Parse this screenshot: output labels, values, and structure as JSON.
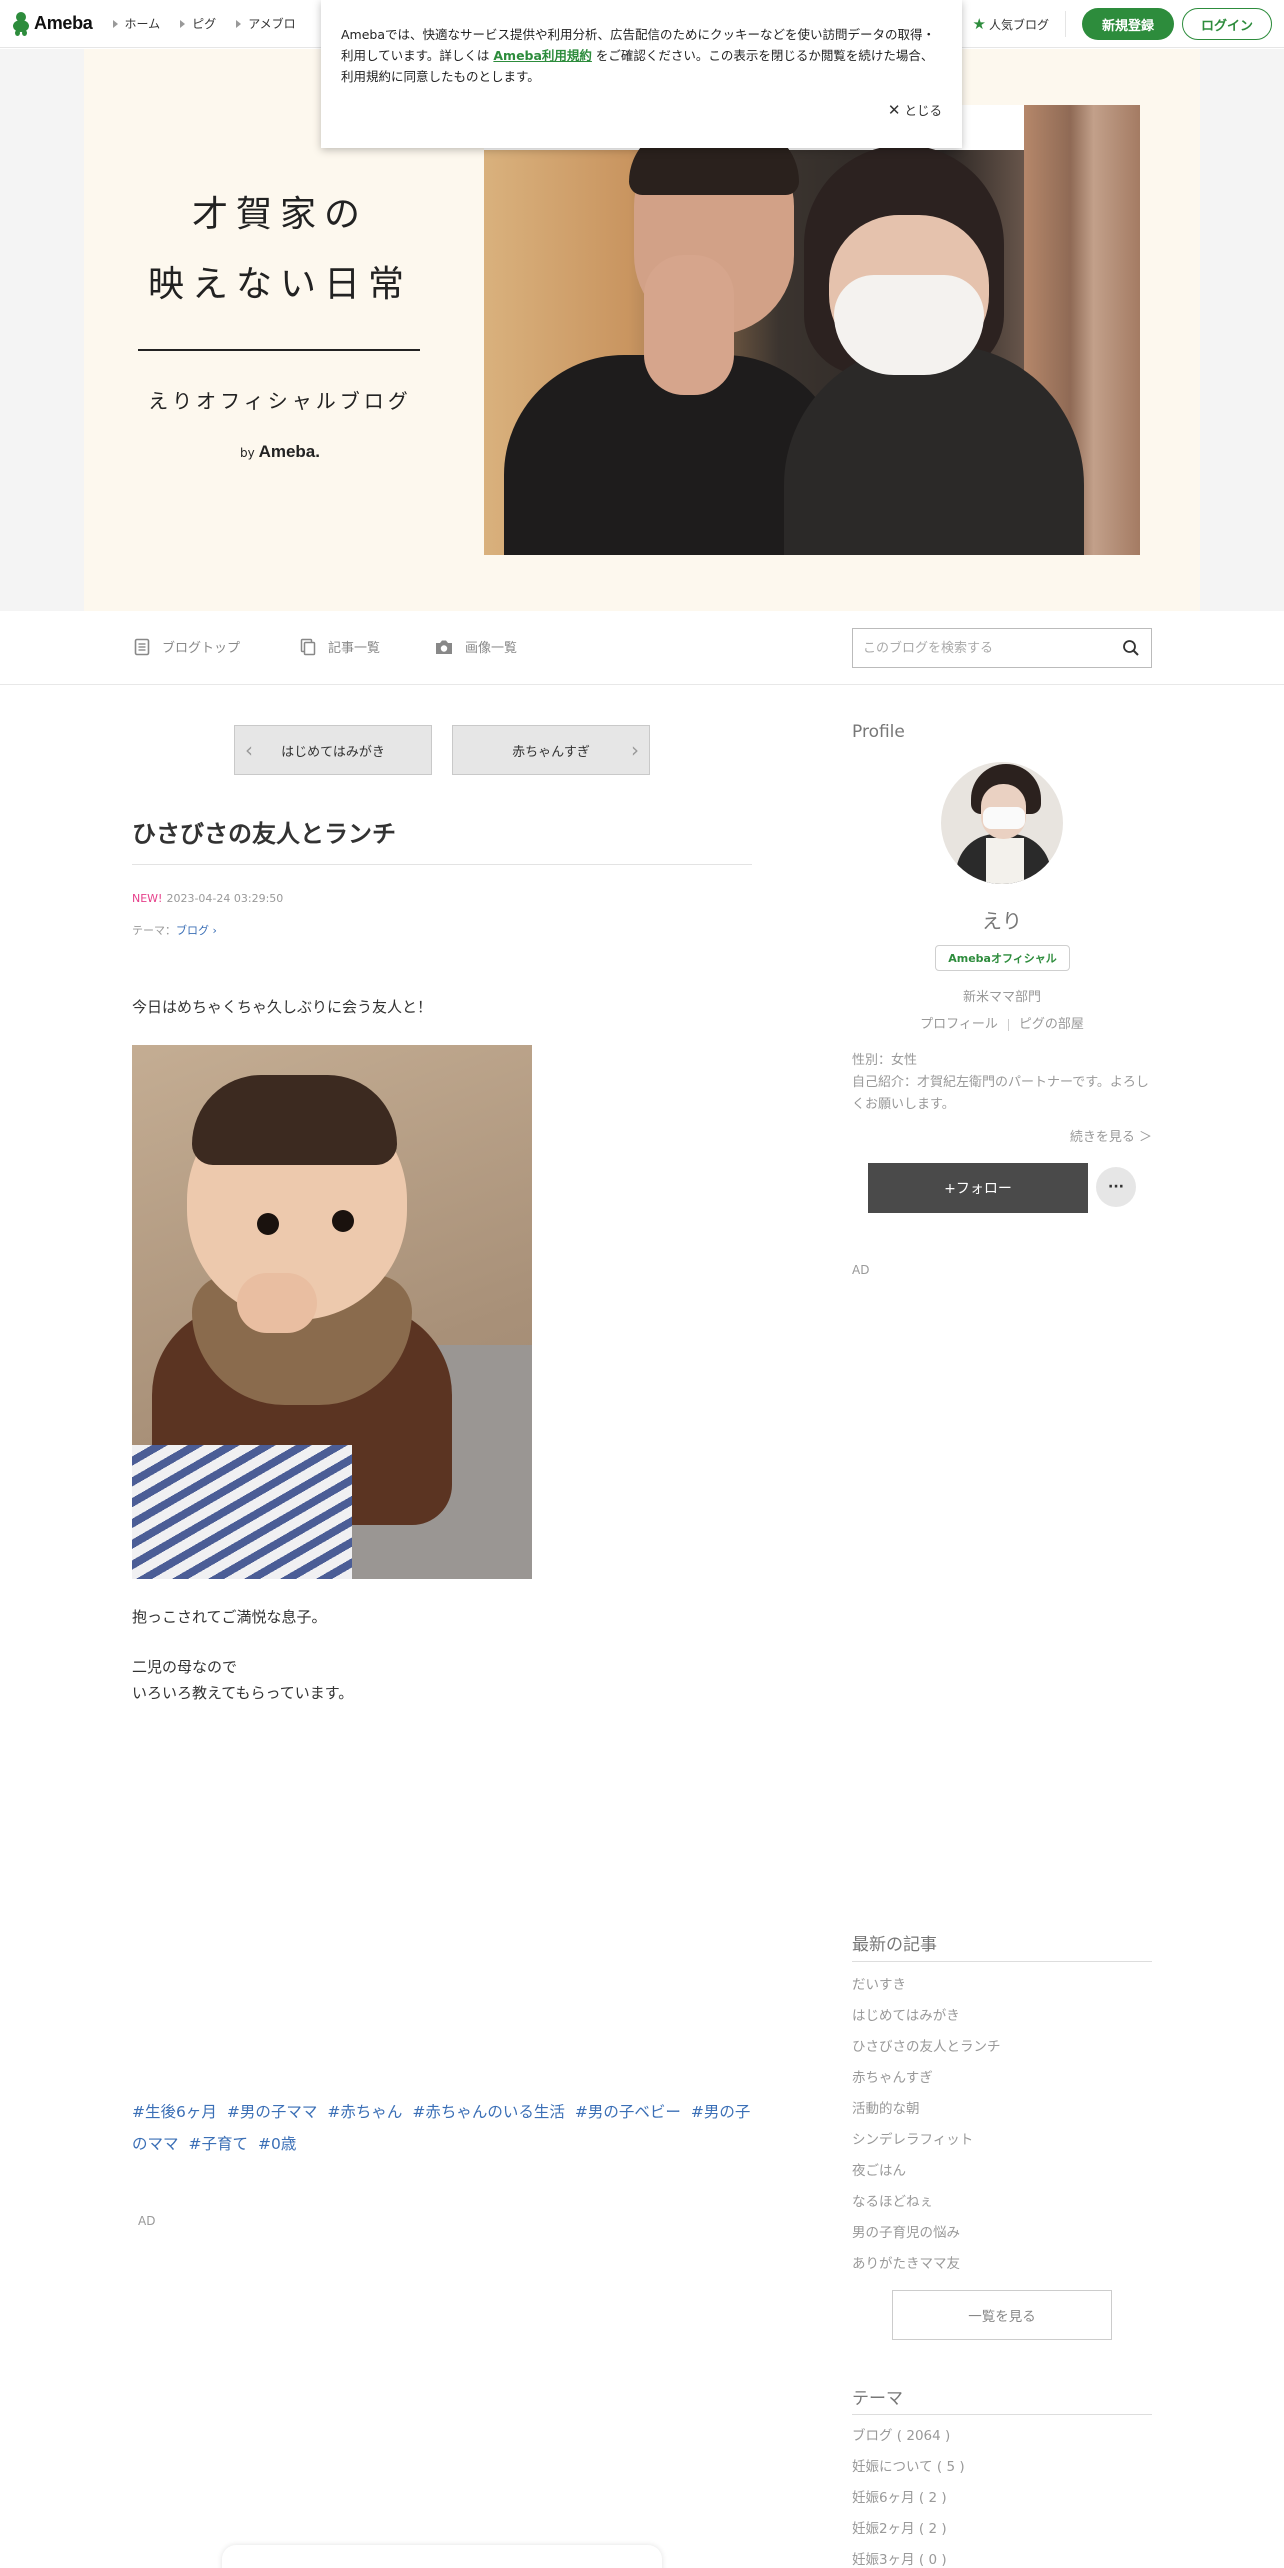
{
  "topbar": {
    "logo": "Ameba",
    "nav": [
      "ホーム",
      "ピグ",
      "アメブロ"
    ],
    "popular": "人気ブログ",
    "register": "新規登録",
    "login": "ログイン"
  },
  "cookie": {
    "text_before": "Amebaでは、快適なサービス提供や利用分析、広告配信のためにクッキーなどを使い訪問データの取得・利用しています。詳しくは",
    "link": "Ameba利用規約",
    "text_after": "をご確認ください。この表示を閉じるか閲覧を続けた場合、利用規約に同意したものとします。",
    "close": "とじる"
  },
  "header": {
    "title_line1": "才賀家の",
    "title_line2": "映えない日常",
    "subtitle": "えりオフィシャルブログ",
    "by": "by",
    "by_brand": "Ameba."
  },
  "blognav": {
    "top": "ブログトップ",
    "list": "記事一覧",
    "images": "画像一覧",
    "search_placeholder": "このブログを検索する"
  },
  "pager": {
    "prev": "はじめてはみがき",
    "next": "赤ちゃんすぎ"
  },
  "article": {
    "title": "ひさびさの友人とランチ",
    "new_label": "NEW!",
    "date": "2023-04-24 03:29:50",
    "theme_prefix": "テーマ：",
    "theme": "ブログ",
    "p1": "今日はめちゃくちゃ久しぶりに会う友人と！",
    "p2": "抱っこされてご満悦な息子。",
    "p3_line1": "二児の母なので",
    "p3_line2": "いろいろ教えてもらっています。",
    "hashtags": [
      "#生後6ヶ月",
      "#男の子ママ",
      "#赤ちゃん",
      "#赤ちゃんのいる生活",
      "#男の子ベビー",
      "#男の子のママ",
      "#子育て",
      "#0歳"
    ],
    "ad": "AD"
  },
  "sidebar": {
    "profile_heading": "Profile",
    "name": "えり",
    "badge": "Amebaオフィシャル",
    "category": "新米ママ部門",
    "link_profile": "プロフィール",
    "link_pig": "ピグの部屋",
    "gender": "性別：女性",
    "intro": "自己紹介：才賀紀左衛門のパートナーです。よろしくお願いします。",
    "more": "続きを見る ＞",
    "follow": "+フォロー",
    "more_btn": "···",
    "ad": "AD",
    "recent_heading": "最新の記事",
    "recent": [
      "だいすき",
      "はじめてはみがき",
      "ひさびさの友人とランチ",
      "赤ちゃんすぎ",
      "活動的な朝",
      "シンデレラフィット",
      "夜ごはん",
      "なるほどねぇ",
      "男の子育児の悩み",
      "ありがたきママ友"
    ],
    "see_all": "一覧を見る",
    "theme_heading": "テーマ",
    "themes": [
      "ブログ ( 2064 )",
      "妊娠について ( 5 )",
      "妊娠6ヶ月 ( 2 )",
      "妊娠2ヶ月 ( 2 )",
      "妊娠3ヶ月 ( 0 )"
    ]
  }
}
